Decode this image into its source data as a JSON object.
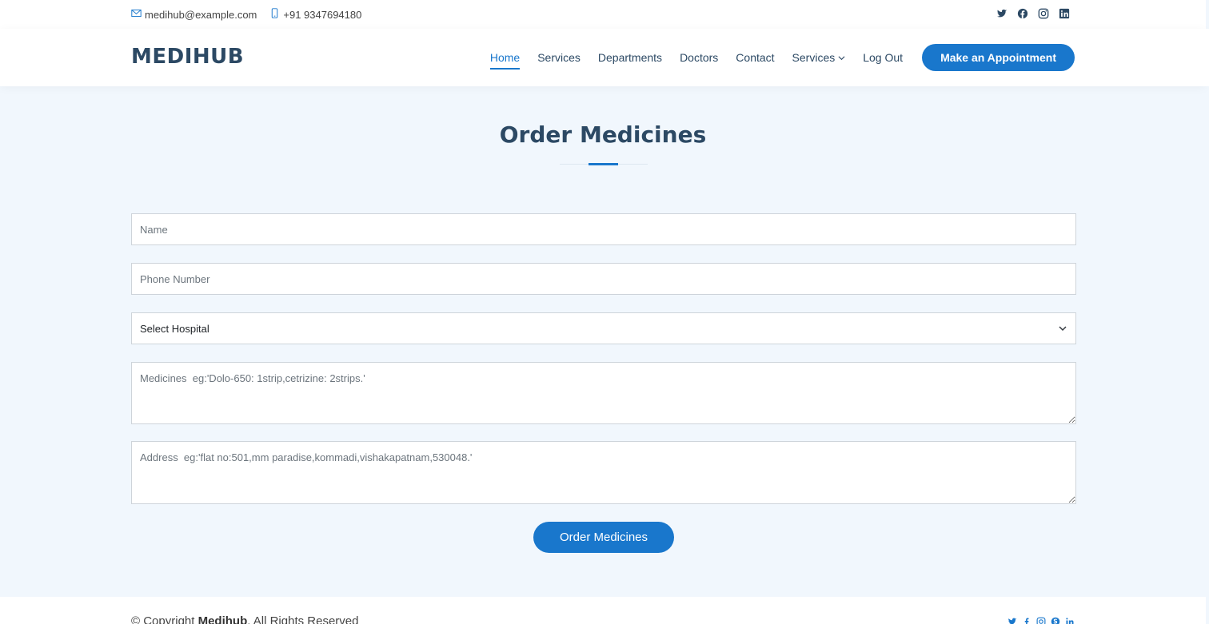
{
  "topbar": {
    "email": "medihub@example.com",
    "phone": "+91 9347694180",
    "social_icons": [
      "twitter-icon",
      "facebook-icon",
      "instagram-icon",
      "linkedin-icon"
    ]
  },
  "header": {
    "logo": "MEDIHUB",
    "nav": [
      {
        "label": "Home",
        "active": true
      },
      {
        "label": "Services",
        "active": false
      },
      {
        "label": "Departments",
        "active": false
      },
      {
        "label": "Doctors",
        "active": false
      },
      {
        "label": "Contact",
        "active": false
      },
      {
        "label": "Services",
        "active": false,
        "dropdown": true
      },
      {
        "label": "Log Out",
        "active": false
      }
    ],
    "appointment_button": "Make an Appointment"
  },
  "section": {
    "title": "Order Medicines"
  },
  "form": {
    "name_placeholder": "Name",
    "phone_placeholder": "Phone Number",
    "hospital_select": "Select Hospital",
    "medicines_placeholder": "Medicines  eg:'Dolo-650: 1strip,cetrizine: 2strips.'",
    "address_placeholder": "Address  eg:'flat no:501,mm paradise,kommadi,vishakapatnam,530048.'",
    "submit_label": "Order Medicines"
  },
  "footer": {
    "copyright_prefix": "© Copyright ",
    "brand": "Medihub",
    "copyright_suffix": ". All Rights Reserved",
    "social_icons": [
      "twitter-icon",
      "facebook-icon",
      "instagram-icon",
      "skype-icon",
      "linkedin-icon"
    ]
  },
  "colors": {
    "accent": "#1977cc",
    "heading": "#2c4964",
    "background": "#f1f7fd"
  }
}
